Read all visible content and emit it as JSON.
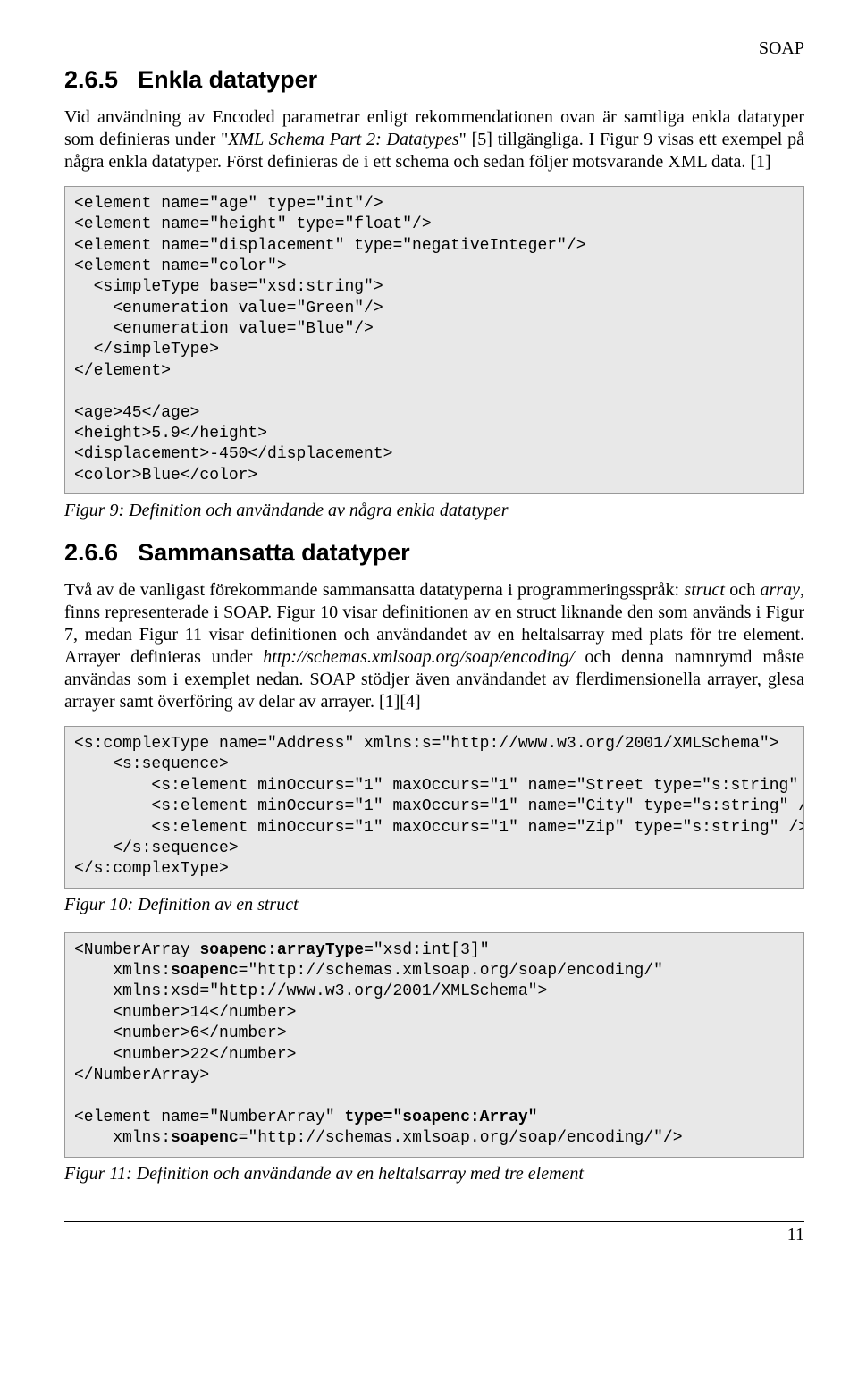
{
  "header": {
    "label": "SOAP"
  },
  "section1": {
    "number": "2.6.5",
    "title": "Enkla datatyper",
    "para1_a": "Vid användning av Encoded parametrar enligt rekommendationen ovan är samtliga enkla datatyper som definieras under \"",
    "para1_i": "XML Schema Part 2: Datatypes",
    "para1_b": "\" [5] tillgängliga. I Figur 9 visas ett exempel på några enkla datatyper. Först definieras de i ett schema och sedan följer motsvarande XML data. [1]",
    "code": "<element name=\"age\" type=\"int\"/>\n<element name=\"height\" type=\"float\"/>\n<element name=\"displacement\" type=\"negativeInteger\"/>\n<element name=\"color\">\n  <simpleType base=\"xsd:string\">\n    <enumeration value=\"Green\"/>\n    <enumeration value=\"Blue\"/>\n  </simpleType>\n</element>\n\n<age>45</age>\n<height>5.9</height>\n<displacement>-450</displacement>\n<color>Blue</color>",
    "caption": "Figur 9: Definition och användande av några enkla datatyper"
  },
  "section2": {
    "number": "2.6.6",
    "title": "Sammansatta datatyper",
    "para_a": "Två av de vanligast förekommande sammansatta datatyperna i programmeringsspråk: ",
    "para_i1": "struct",
    "para_b": " och ",
    "para_i2": "array",
    "para_c": ", finns representerade i SOAP. Figur 10 visar definitionen av en struct liknande den som används i Figur 7, medan Figur 11 visar definitionen och användandet av en heltalsarray med plats för tre element. Arrayer definieras under ",
    "para_i3": "http://schemas.xmlsoap.org/soap/encoding/",
    "para_d": " och denna namnrymd måste användas som i exemplet nedan. SOAP stödjer även användandet av flerdimensionella arrayer, glesa arrayer samt överföring av delar av arrayer. [1][4]",
    "code1": "<s:complexType name=\"Address\" xmlns:s=\"http://www.w3.org/2001/XMLSchema\">\n    <s:sequence>\n        <s:element minOccurs=\"1\" maxOccurs=\"1\" name=\"Street type=\"s:string\" />\n        <s:element minOccurs=\"1\" maxOccurs=\"1\" name=\"City\" type=\"s:string\" />\n        <s:element minOccurs=\"1\" maxOccurs=\"1\" name=\"Zip\" type=\"s:string\" />\n    </s:sequence>\n</s:complexType>",
    "caption1": "Figur 10: Definition av en struct",
    "code2_l1": "<NumberArray ",
    "code2_l1b": "soapenc:arrayType",
    "code2_l1c": "=\"xsd:int[3]\"",
    "code2_l2a": "    xmlns:",
    "code2_l2b": "soapenc",
    "code2_l2c": "=\"http://schemas.xmlsoap.org/soap/encoding/\"",
    "code2_l3": "    xmlns:xsd=\"http://www.w3.org/2001/XMLSchema\">",
    "code2_l4": "    <number>14</number>",
    "code2_l5": "    <number>6</number>",
    "code2_l6": "    <number>22</number>",
    "code2_l7": "</NumberArray>",
    "code2_blank": "",
    "code2_l8a": "<element name=\"NumberArray\" ",
    "code2_l8b": "type=\"soapenc:Array\"",
    "code2_l9a": "    xmlns:",
    "code2_l9b": "soapenc",
    "code2_l9c": "=\"http://schemas.xmlsoap.org/soap/encoding/\"/>",
    "caption2": "Figur 11: Definition och användande av en heltalsarray med tre element"
  },
  "footer": {
    "pagenum": "11"
  }
}
